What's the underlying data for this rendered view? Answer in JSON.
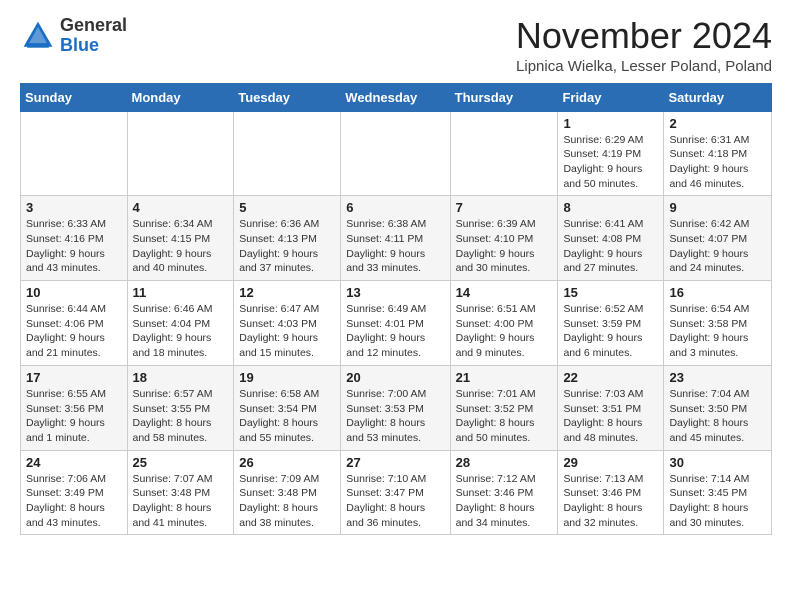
{
  "logo": {
    "general": "General",
    "blue": "Blue"
  },
  "header": {
    "month_title": "November 2024",
    "location": "Lipnica Wielka, Lesser Poland, Poland"
  },
  "columns": [
    "Sunday",
    "Monday",
    "Tuesday",
    "Wednesday",
    "Thursday",
    "Friday",
    "Saturday"
  ],
  "weeks": [
    [
      {
        "day": "",
        "info": ""
      },
      {
        "day": "",
        "info": ""
      },
      {
        "day": "",
        "info": ""
      },
      {
        "day": "",
        "info": ""
      },
      {
        "day": "",
        "info": ""
      },
      {
        "day": "1",
        "info": "Sunrise: 6:29 AM\nSunset: 4:19 PM\nDaylight: 9 hours and 50 minutes."
      },
      {
        "day": "2",
        "info": "Sunrise: 6:31 AM\nSunset: 4:18 PM\nDaylight: 9 hours and 46 minutes."
      }
    ],
    [
      {
        "day": "3",
        "info": "Sunrise: 6:33 AM\nSunset: 4:16 PM\nDaylight: 9 hours and 43 minutes."
      },
      {
        "day": "4",
        "info": "Sunrise: 6:34 AM\nSunset: 4:15 PM\nDaylight: 9 hours and 40 minutes."
      },
      {
        "day": "5",
        "info": "Sunrise: 6:36 AM\nSunset: 4:13 PM\nDaylight: 9 hours and 37 minutes."
      },
      {
        "day": "6",
        "info": "Sunrise: 6:38 AM\nSunset: 4:11 PM\nDaylight: 9 hours and 33 minutes."
      },
      {
        "day": "7",
        "info": "Sunrise: 6:39 AM\nSunset: 4:10 PM\nDaylight: 9 hours and 30 minutes."
      },
      {
        "day": "8",
        "info": "Sunrise: 6:41 AM\nSunset: 4:08 PM\nDaylight: 9 hours and 27 minutes."
      },
      {
        "day": "9",
        "info": "Sunrise: 6:42 AM\nSunset: 4:07 PM\nDaylight: 9 hours and 24 minutes."
      }
    ],
    [
      {
        "day": "10",
        "info": "Sunrise: 6:44 AM\nSunset: 4:06 PM\nDaylight: 9 hours and 21 minutes."
      },
      {
        "day": "11",
        "info": "Sunrise: 6:46 AM\nSunset: 4:04 PM\nDaylight: 9 hours and 18 minutes."
      },
      {
        "day": "12",
        "info": "Sunrise: 6:47 AM\nSunset: 4:03 PM\nDaylight: 9 hours and 15 minutes."
      },
      {
        "day": "13",
        "info": "Sunrise: 6:49 AM\nSunset: 4:01 PM\nDaylight: 9 hours and 12 minutes."
      },
      {
        "day": "14",
        "info": "Sunrise: 6:51 AM\nSunset: 4:00 PM\nDaylight: 9 hours and 9 minutes."
      },
      {
        "day": "15",
        "info": "Sunrise: 6:52 AM\nSunset: 3:59 PM\nDaylight: 9 hours and 6 minutes."
      },
      {
        "day": "16",
        "info": "Sunrise: 6:54 AM\nSunset: 3:58 PM\nDaylight: 9 hours and 3 minutes."
      }
    ],
    [
      {
        "day": "17",
        "info": "Sunrise: 6:55 AM\nSunset: 3:56 PM\nDaylight: 9 hours and 1 minute."
      },
      {
        "day": "18",
        "info": "Sunrise: 6:57 AM\nSunset: 3:55 PM\nDaylight: 8 hours and 58 minutes."
      },
      {
        "day": "19",
        "info": "Sunrise: 6:58 AM\nSunset: 3:54 PM\nDaylight: 8 hours and 55 minutes."
      },
      {
        "day": "20",
        "info": "Sunrise: 7:00 AM\nSunset: 3:53 PM\nDaylight: 8 hours and 53 minutes."
      },
      {
        "day": "21",
        "info": "Sunrise: 7:01 AM\nSunset: 3:52 PM\nDaylight: 8 hours and 50 minutes."
      },
      {
        "day": "22",
        "info": "Sunrise: 7:03 AM\nSunset: 3:51 PM\nDaylight: 8 hours and 48 minutes."
      },
      {
        "day": "23",
        "info": "Sunrise: 7:04 AM\nSunset: 3:50 PM\nDaylight: 8 hours and 45 minutes."
      }
    ],
    [
      {
        "day": "24",
        "info": "Sunrise: 7:06 AM\nSunset: 3:49 PM\nDaylight: 8 hours and 43 minutes."
      },
      {
        "day": "25",
        "info": "Sunrise: 7:07 AM\nSunset: 3:48 PM\nDaylight: 8 hours and 41 minutes."
      },
      {
        "day": "26",
        "info": "Sunrise: 7:09 AM\nSunset: 3:48 PM\nDaylight: 8 hours and 38 minutes."
      },
      {
        "day": "27",
        "info": "Sunrise: 7:10 AM\nSunset: 3:47 PM\nDaylight: 8 hours and 36 minutes."
      },
      {
        "day": "28",
        "info": "Sunrise: 7:12 AM\nSunset: 3:46 PM\nDaylight: 8 hours and 34 minutes."
      },
      {
        "day": "29",
        "info": "Sunrise: 7:13 AM\nSunset: 3:46 PM\nDaylight: 8 hours and 32 minutes."
      },
      {
        "day": "30",
        "info": "Sunrise: 7:14 AM\nSunset: 3:45 PM\nDaylight: 8 hours and 30 minutes."
      }
    ]
  ]
}
